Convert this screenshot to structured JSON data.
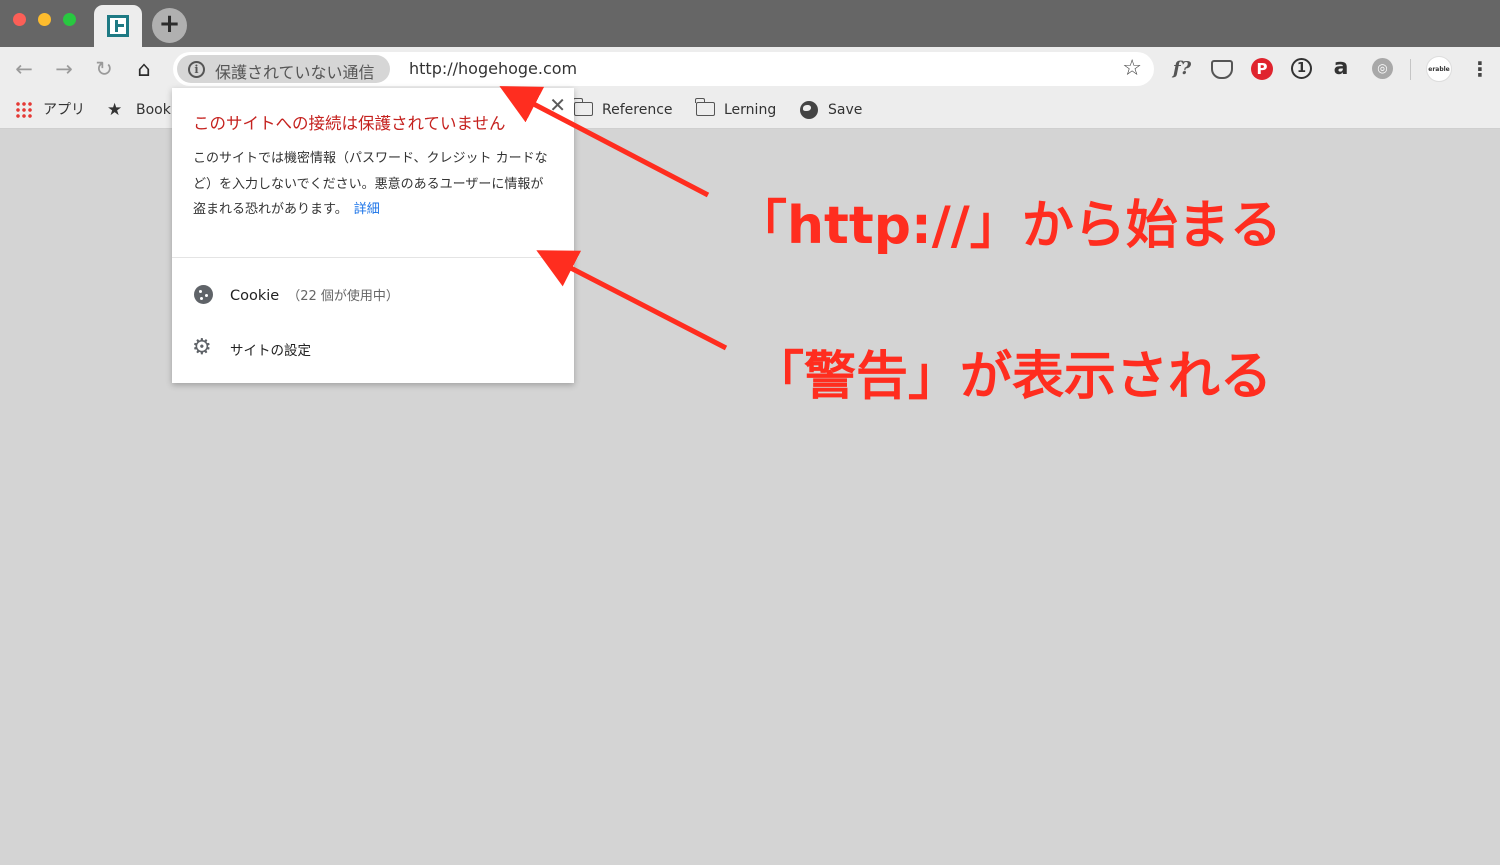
{
  "browser": {
    "tab_icon": "hatena-blog-favicon",
    "new_tab_label": "+",
    "toolbar": {
      "back_icon": "←",
      "forward_icon": "→",
      "reload_icon": "↻",
      "home_icon": "⌂"
    },
    "omnibox": {
      "security_label": "保護されていない通信",
      "url": "http://hogehoge.com",
      "bookmark_star": "☆"
    },
    "extensions": {
      "fonts_ext": "f?",
      "pocket": "◡",
      "pinterest": "P",
      "onepassword": "1",
      "amazon": "a",
      "grey_ext": "◎",
      "erable": "erable",
      "menu": "⋮"
    },
    "bookmarks": {
      "apps": "アプリ",
      "book": "Book",
      "reference": "Reference",
      "lerning": "Lerning",
      "save": "Save"
    }
  },
  "popup": {
    "close": "✕",
    "title": "このサイトへの接続は保護されていません",
    "body": "このサイトでは機密情報（パスワード、クレジット カードなど）を入力しないでください。悪意のあるユーザーに情報が盗まれる恐れがあります。",
    "details_link": "詳細",
    "cookie_label": "Cookie",
    "cookie_count": "（22 個が使用中）",
    "site_settings": "サイトの設定"
  },
  "annotations": {
    "http_note": "「http://」から始まる",
    "warning_note": "「警告」が表示される",
    "color": "#ff2d1f"
  }
}
